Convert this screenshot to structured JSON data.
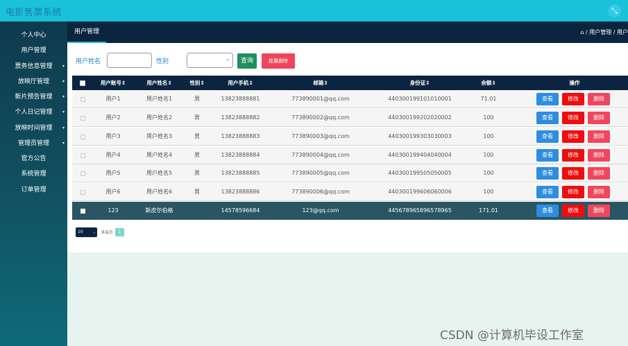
{
  "app": {
    "title": "电影售票系统"
  },
  "topbar": {
    "fullscreen_icon": "⤡"
  },
  "sidebar": {
    "items": [
      {
        "label": "个人中心",
        "arrow": ""
      },
      {
        "label": "用户管理",
        "arrow": ""
      },
      {
        "label": "票务信息管理",
        "arrow": "▾"
      },
      {
        "label": "放映厅管理",
        "arrow": "▾"
      },
      {
        "label": "新片预告管理",
        "arrow": "▾"
      },
      {
        "label": "个人日记管理",
        "arrow": "▾"
      },
      {
        "label": "放映时间管理",
        "arrow": "▾"
      },
      {
        "label": "管理员管理",
        "arrow": "▾"
      },
      {
        "label": "官方公告",
        "arrow": ""
      },
      {
        "label": "系统管理",
        "arrow": ""
      },
      {
        "label": "订单管理",
        "arrow": ""
      }
    ]
  },
  "breadcrumb": {
    "tab": "用户管理",
    "path": "⌂ / 用户管理 / 用户"
  },
  "filter": {
    "name_label": "用户姓名",
    "gender_label": "性别",
    "select_caret": "⌄",
    "query_button": "查询",
    "batch_delete_button": "批量删除"
  },
  "table": {
    "columns": [
      "用户账号⇕",
      "用户姓名⇕",
      "性别⇕",
      "用户手机⇕",
      "邮箱⇕",
      "身份证⇕",
      "余额⇕",
      "操作"
    ],
    "rows": [
      {
        "account": "用户1",
        "name": "用户姓名1",
        "gender": "男",
        "phone": "13823888881",
        "email": "773890001@qq.com",
        "id_card": "440300199101010001",
        "balance": "71.01"
      },
      {
        "account": "用户2",
        "name": "用户姓名2",
        "gender": "男",
        "phone": "13823888882",
        "email": "773890002@qq.com",
        "id_card": "440300199202020002",
        "balance": "100"
      },
      {
        "account": "用户3",
        "name": "用户姓名3",
        "gender": "男",
        "phone": "13823888883",
        "email": "773890003@qq.com",
        "id_card": "440300199303030003",
        "balance": "100"
      },
      {
        "account": "用户4",
        "name": "用户姓名4",
        "gender": "男",
        "phone": "13823888884",
        "email": "773890004@qq.com",
        "id_card": "440300199404040004",
        "balance": "100"
      },
      {
        "account": "用户5",
        "name": "用户姓名5",
        "gender": "男",
        "phone": "13823888885",
        "email": "773890005@qq.com",
        "id_card": "440300199505050005",
        "balance": "100"
      },
      {
        "account": "用户6",
        "name": "用户姓名6",
        "gender": "男",
        "phone": "13823888886",
        "email": "773890006@qq.com",
        "id_card": "440300199606060006",
        "balance": "100"
      },
      {
        "account": "123",
        "name": "斯皮尔伯格",
        "gender": "",
        "phone": "14578596684",
        "email": "123@qq.com",
        "id_card": "445678965896578965",
        "balance": "171.01"
      }
    ],
    "actions": {
      "view": "查看",
      "edit": "修改",
      "delete": "删除"
    }
  },
  "pagination": {
    "page_size": "10",
    "per_page_label": "条每页",
    "current_page": "1"
  },
  "watermark": "CSDN @计算机毕设工作室",
  "colors": {
    "topbar": "#19c1d9",
    "header_dark": "#0b2540",
    "highlight_row": "#2a5563",
    "view_button": "#2d8de0",
    "edit_button": "#ef0d0d",
    "delete_button": "#f0465b",
    "query_button": "#1e8f5e"
  }
}
